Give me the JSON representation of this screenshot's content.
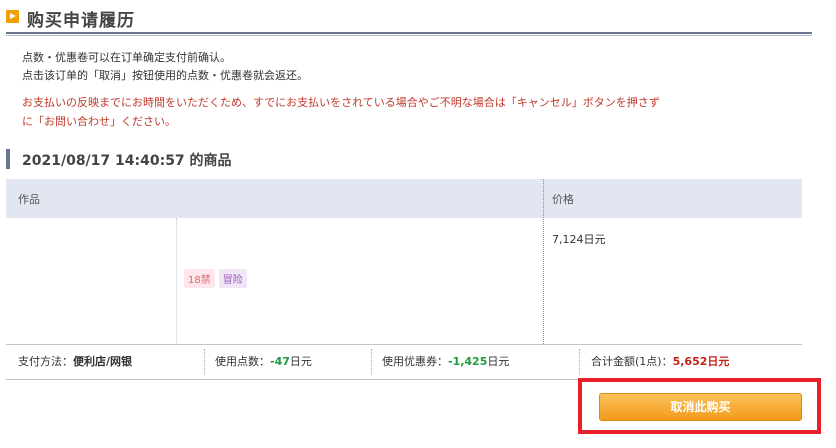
{
  "header": {
    "title": "购买申请履历"
  },
  "notices": [
    "点数・优惠卷可以在订单确定支付前确认。",
    "点击该订单的「取消」按钮使用的点数・优惠卷就会返还。"
  ],
  "warnings": [
    "お支払いの反映までにお時間をいただくため、すでにお支払いをされている場合やご不明な場合は「キャンセル」ボタンを押さず",
    "に「お問い合わせ」ください。"
  ],
  "order": {
    "title": "2021/08/17 14:40:57 的商品",
    "columns": {
      "work": "作品",
      "price": "价格"
    },
    "item": {
      "price": "7,124日元",
      "tags": [
        "18禁",
        "冒险"
      ]
    },
    "summary": {
      "payment_label": "支付方法：",
      "payment_value": "便利店/网银",
      "points_label": "使用点数：",
      "points_value": "-47",
      "points_unit": "日元",
      "coupon_label": "使用优惠券：",
      "coupon_value": "-1,425",
      "coupon_unit": "日元",
      "total_label": "合计金额(1点)：",
      "total_value": "5,652日元"
    }
  },
  "actions": {
    "cancel_label": "取消此购买"
  },
  "colors": {
    "accent": "#f29a1c",
    "highlight": "#e8202a",
    "header_bg": "#e1e6f0"
  }
}
